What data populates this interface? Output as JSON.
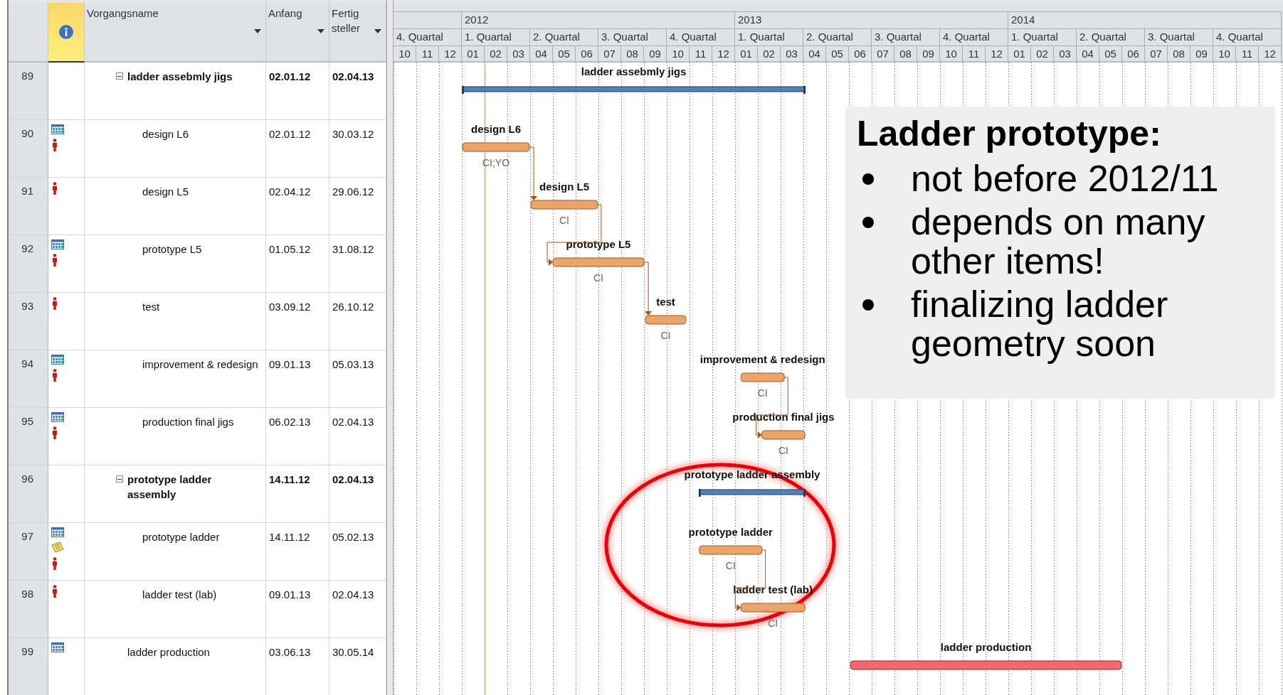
{
  "table": {
    "columns": [
      {
        "label": "Vorgangsname"
      },
      {
        "label": "Anfang"
      },
      {
        "label": "Fertig steller"
      }
    ],
    "rows": [
      {
        "id": "89",
        "name": "ladder assebmly jigs",
        "start": "02.01.12",
        "finish": "02.04.13",
        "kind": "summary",
        "expanded": true,
        "bar_label": "ladder assebmly jigs",
        "children": [
          {
            "id": "90",
            "name": "design L6",
            "start": "02.01.12",
            "finish": "30.03.12",
            "kind": "task",
            "critical": false,
            "indicators": [
              {
                "kind": "calendar"
              },
              {
                "kind": "person"
              }
            ],
            "bar_label": "design L6",
            "resources": "CI;YO",
            "linked_to_next": true
          },
          {
            "id": "91",
            "name": "design L5",
            "start": "02.04.12",
            "finish": "29.06.12",
            "kind": "task",
            "critical": false,
            "indicators": [
              {
                "kind": "person"
              }
            ],
            "bar_label": "design L5",
            "resources": "CI",
            "linked_to_next": true
          },
          {
            "id": "92",
            "name": "prototype L5",
            "start": "01.05.12",
            "finish": "31.08.12",
            "kind": "task",
            "critical": false,
            "indicators": [
              {
                "kind": "calendar"
              },
              {
                "kind": "person"
              }
            ],
            "bar_label": "prototype L5",
            "resources": "CI",
            "linked_to_next": true
          },
          {
            "id": "93",
            "name": "test",
            "start": "03.09.12",
            "finish": "26.10.12",
            "kind": "task",
            "critical": false,
            "indicators": [
              {
                "kind": "person"
              }
            ],
            "bar_label": "test",
            "resources": "CI",
            "linked_to_next": false
          },
          {
            "id": "94",
            "name": "improvement & redesign",
            "start": "09.01.13",
            "finish": "05.03.13",
            "kind": "task",
            "critical": false,
            "indicators": [
              {
                "kind": "calendar"
              },
              {
                "kind": "person"
              }
            ],
            "bar_label": "improvement & redesign",
            "resources": "CI",
            "linked_to_next": true
          },
          {
            "id": "95",
            "name": "production final jigs",
            "start": "06.02.13",
            "finish": "02.04.13",
            "kind": "task",
            "critical": false,
            "indicators": [
              {
                "kind": "calendar"
              },
              {
                "kind": "person"
              }
            ],
            "bar_label": "production final jigs",
            "resources": "CI",
            "linked_to_next": false
          }
        ]
      },
      {
        "id": "96",
        "name": "prototype ladder assembly",
        "start": "14.11.12",
        "finish": "02.04.13",
        "kind": "summary",
        "expanded": true,
        "bar_label": "prototype ladder assembly",
        "children": [
          {
            "id": "97",
            "name": "prototype ladder",
            "start": "14.11.12",
            "finish": "05.02.13",
            "kind": "task",
            "critical": false,
            "indicators": [
              {
                "kind": "calendar"
              },
              {
                "kind": "note"
              },
              {
                "kind": "person"
              }
            ],
            "bar_label": "prototype ladder",
            "resources": "CI",
            "linked_to_next": true
          },
          {
            "id": "98",
            "name": "ladder test (lab)",
            "start": "09.01.13",
            "finish": "02.04.13",
            "kind": "task",
            "critical": false,
            "indicators": [
              {
                "kind": "person"
              }
            ],
            "bar_label": "ladder test (lab)",
            "resources": "CI",
            "linked_to_next": false
          }
        ]
      },
      {
        "id": "99",
        "name": "ladder production",
        "start": "03.06.13",
        "finish": "30.05.14",
        "kind": "task",
        "critical": true,
        "indicators": [
          {
            "kind": "calendar"
          }
        ],
        "bar_label": "ladder production"
      }
    ]
  },
  "timescale": {
    "years": [
      {
        "quarters": [
          {
            "label": "4. Quartal",
            "months": [
              "10",
              "11",
              "12"
            ]
          }
        ]
      },
      {
        "label": "2012",
        "quarters": [
          {
            "label": "1. Quartal",
            "months": [
              "01",
              "02",
              "03"
            ]
          },
          {
            "label": "2. Quartal",
            "months": [
              "04",
              "05",
              "06"
            ]
          },
          {
            "label": "3. Quartal",
            "months": [
              "07",
              "08",
              "09"
            ]
          },
          {
            "label": "4. Quartal",
            "months": [
              "10",
              "11",
              "12"
            ]
          }
        ]
      },
      {
        "label": "2013",
        "quarters": [
          {
            "label": "1. Quartal",
            "months": [
              "01",
              "02",
              "03"
            ]
          },
          {
            "label": "2. Quartal",
            "months": [
              "04",
              "05",
              "06"
            ]
          },
          {
            "label": "3. Quartal",
            "months": [
              "07",
              "08",
              "09"
            ]
          },
          {
            "label": "4. Quartal",
            "months": [
              "10",
              "11",
              "12"
            ]
          }
        ]
      },
      {
        "label": "2014",
        "quarters": [
          {
            "label": "1. Quartal",
            "months": [
              "01",
              "02",
              "03"
            ]
          },
          {
            "label": "2. Quartal",
            "months": [
              "04",
              "05",
              "06"
            ]
          },
          {
            "label": "3. Quartal",
            "months": [
              "07",
              "08",
              "09"
            ]
          },
          {
            "label": "4. Quartal",
            "months": [
              "10",
              "11",
              "12"
            ]
          }
        ]
      }
    ]
  },
  "callout": {
    "title": "Ladder prototype:",
    "bullets": [
      "not before 2012/11",
      "depends on many other items!",
      "finalizing ladder geometry soon"
    ]
  }
}
